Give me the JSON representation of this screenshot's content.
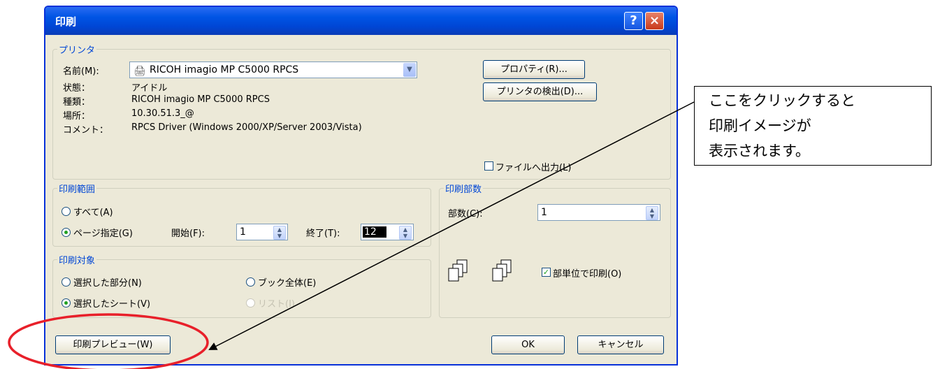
{
  "dialog": {
    "title": "印刷",
    "help_icon": "?",
    "close_icon": "×"
  },
  "printer": {
    "group_label": "プリンタ",
    "name_label": "名前(M):",
    "name_value": "RICOH imagio MP C5000 RPCS",
    "status_label": "状態：",
    "status_value": "アイドル",
    "type_label": "種類：",
    "type_value": "RICOH imagio MP C5000 RPCS",
    "location_label": "場所：",
    "location_value": "10.30.51.3_@",
    "comment_label": "コメント：",
    "comment_value": "RPCS Driver (Windows 2000/XP/Server 2003/Vista)",
    "properties_button": "プロパティ(R)...",
    "find_printer_button": "プリンタの検出(D)...",
    "print_to_file": "ファイルへ出力(L)",
    "print_to_file_checked": false
  },
  "range": {
    "group_label": "印刷範囲",
    "all_label": "すべて(A)",
    "pages_label": "ページ指定(G)",
    "selected": "pages",
    "from_label": "開始(F):",
    "from_value": "1",
    "to_label": "終了(T):",
    "to_value": "12"
  },
  "copies": {
    "group_label": "印刷部数",
    "count_label": "部数(C):",
    "count_value": "1",
    "collate_label": "部単位で印刷(O)",
    "collate_checked": true
  },
  "target": {
    "group_label": "印刷対象",
    "selection_label": "選択した部分(N)",
    "workbook_label": "ブック全体(E)",
    "sheets_label": "選択したシート(V)",
    "list_label": "リスト(I)",
    "selected": "sheets"
  },
  "footer": {
    "preview_button": "印刷プレビュー(W)",
    "ok_button": "OK",
    "cancel_button": "キャンセル"
  },
  "annotation": {
    "lines": [
      "ここをクリックすると",
      "印刷イメージが",
      "表示されます。"
    ],
    "highlight_color": "#e8202a"
  }
}
